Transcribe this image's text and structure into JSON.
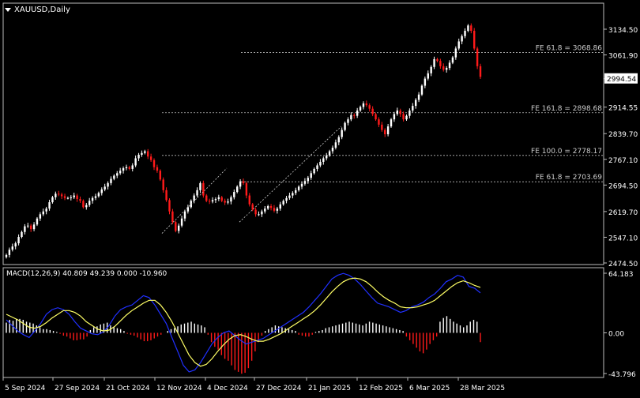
{
  "header": {
    "symbol": "XAUUSD,Daily"
  },
  "price_axis_labels": [
    "3134.50",
    "3061.90",
    "2994.54",
    "2914.55",
    "2839.70",
    "2767.10",
    "2694.50",
    "2619.70",
    "2547.10",
    "2474.50"
  ],
  "current_price_label": "2994.54",
  "macd_axis_labels": [
    "64.183",
    "0.00",
    "-43.796"
  ],
  "date_labels": [
    "5 Sep 2024",
    "27 Sep 2024",
    "21 Oct 2024",
    "12 Nov 2024",
    "4 Dec 2024",
    "27 Dec 2024",
    "21 Jan 2025",
    "12 Feb 2025",
    "6 Mar 2025",
    "28 Mar 2025"
  ],
  "fib_levels": [
    {
      "label": "FE 61.8 = 3068.86",
      "value": 3068.86
    },
    {
      "label": "FE 161.8 = 2898.68",
      "value": 2898.68
    },
    {
      "label": "FE 100.0 = 2778.17",
      "value": 2778.17
    },
    {
      "label": "FE 61.8 = 2703.69",
      "value": 2703.69
    }
  ],
  "macd_label": "MACD(12,26,9) 40.809 49.239 0.000 -10.960",
  "colors": {
    "bull": "#ffffff",
    "bear": "#ff1a1a",
    "macd_line": "#2030ff",
    "signal_line": "#ffff66",
    "grid": "#555555",
    "axis": "#bbbbbb"
  },
  "chart_data": {
    "type": "candlestick",
    "timeframe": "Daily",
    "ylim": [
      2474.5,
      3160
    ],
    "x_labels": [
      "5 Sep 2024",
      "27 Sep 2024",
      "21 Oct 2024",
      "12 Nov 2024",
      "4 Dec 2024",
      "27 Dec 2024",
      "21 Jan 2025",
      "12 Feb 2025",
      "6 Mar 2025",
      "28 Mar 2025"
    ],
    "closes": [
      2497,
      2512,
      2521,
      2530,
      2548,
      2562,
      2578,
      2580,
      2570,
      2583,
      2600,
      2612,
      2620,
      2628,
      2646,
      2660,
      2670,
      2668,
      2663,
      2658,
      2658,
      2660,
      2665,
      2655,
      2650,
      2632,
      2638,
      2650,
      2658,
      2663,
      2672,
      2682,
      2690,
      2700,
      2712,
      2721,
      2728,
      2735,
      2742,
      2745,
      2740,
      2750,
      2770,
      2780,
      2785,
      2790,
      2775,
      2765,
      2745,
      2735,
      2710,
      2680,
      2652,
      2620,
      2590,
      2565,
      2580,
      2600,
      2620,
      2632,
      2650,
      2665,
      2680,
      2700,
      2665,
      2650,
      2648,
      2652,
      2655,
      2660,
      2650,
      2645,
      2648,
      2660,
      2675,
      2690,
      2705,
      2700,
      2665,
      2640,
      2625,
      2612,
      2612,
      2620,
      2628,
      2635,
      2630,
      2622,
      2628,
      2640,
      2650,
      2658,
      2665,
      2672,
      2680,
      2690,
      2698,
      2706,
      2715,
      2728,
      2740,
      2750,
      2760,
      2770,
      2778,
      2790,
      2800,
      2815,
      2830,
      2850,
      2870,
      2880,
      2892,
      2890,
      2905,
      2915,
      2925,
      2920,
      2910,
      2895,
      2880,
      2865,
      2850,
      2838,
      2860,
      2880,
      2895,
      2905,
      2895,
      2880,
      2890,
      2905,
      2918,
      2935,
      2950,
      2975,
      2995,
      3010,
      3028,
      3050,
      3045,
      3030,
      3020,
      3025,
      3040,
      3055,
      3080,
      3100,
      3115,
      3130,
      3145,
      3130,
      3080,
      3030,
      3000
    ],
    "macd_main": [
      14,
      8,
      2,
      -2,
      -5,
      2,
      10,
      20,
      25,
      27,
      25,
      20,
      12,
      5,
      2,
      -1,
      -2,
      1,
      8,
      18,
      25,
      28,
      30,
      35,
      40,
      38,
      30,
      20,
      10,
      -5,
      -20,
      -35,
      -42,
      -40,
      -32,
      -22,
      -12,
      -5,
      0,
      2,
      -3,
      -8,
      -12,
      -10,
      -8,
      -6,
      -2,
      2,
      6,
      10,
      14,
      18,
      22,
      28,
      35,
      42,
      50,
      58,
      62,
      64,
      62,
      58,
      52,
      45,
      38,
      32,
      30,
      28,
      25,
      22,
      24,
      28,
      30,
      33,
      38,
      42,
      48,
      55,
      58,
      62,
      60,
      50,
      48,
      43
    ],
    "macd_signal": [
      20,
      17,
      14,
      10,
      6,
      5,
      7,
      11,
      16,
      20,
      24,
      24,
      22,
      18,
      12,
      8,
      4,
      2,
      3,
      7,
      13,
      19,
      24,
      28,
      32,
      35,
      35,
      30,
      22,
      12,
      0,
      -12,
      -24,
      -32,
      -36,
      -34,
      -28,
      -20,
      -13,
      -7,
      -3,
      -2,
      -4,
      -7,
      -9,
      -9,
      -7,
      -4,
      -1,
      3,
      7,
      11,
      15,
      19,
      24,
      30,
      37,
      44,
      50,
      55,
      58,
      59,
      58,
      55,
      50,
      44,
      39,
      35,
      32,
      28,
      27,
      27,
      28,
      30,
      32,
      35,
      40,
      45,
      50,
      54,
      56,
      54,
      51,
      49
    ],
    "macd_hist": [
      11,
      14,
      13,
      15,
      15,
      14,
      12,
      11,
      10,
      8,
      6,
      4,
      4,
      3,
      2,
      1,
      -1,
      -3,
      -4,
      -6,
      -8,
      -8,
      -7,
      -7,
      -4,
      3,
      6,
      7,
      9,
      10,
      11,
      8,
      6,
      5,
      4,
      2,
      -1,
      -2,
      -3,
      -5,
      -7,
      -9,
      -9,
      -8,
      -6,
      -4,
      -2,
      0,
      2,
      4,
      5,
      7,
      9,
      10,
      11,
      12,
      10,
      9,
      8,
      6,
      -2,
      -10,
      -15,
      -18,
      -24,
      -28,
      -30,
      -35,
      -40,
      -42,
      -44,
      -43,
      -38,
      -30,
      -20,
      -10,
      -3,
      2,
      4,
      6,
      8,
      7,
      6,
      5,
      4,
      3,
      2,
      -2,
      -3,
      -4,
      -4,
      -2,
      1,
      2,
      3,
      5,
      6,
      7,
      8,
      9,
      10,
      11,
      12,
      11,
      10,
      9,
      8,
      10,
      12,
      11,
      10,
      9,
      8,
      7,
      6,
      5,
      4,
      3,
      2,
      -4,
      -8,
      -12,
      -16,
      -20,
      -22,
      -18,
      -12,
      -8,
      -4,
      12,
      16,
      18,
      15,
      12,
      10,
      8,
      6,
      8,
      12,
      14,
      12,
      -10
    ]
  }
}
